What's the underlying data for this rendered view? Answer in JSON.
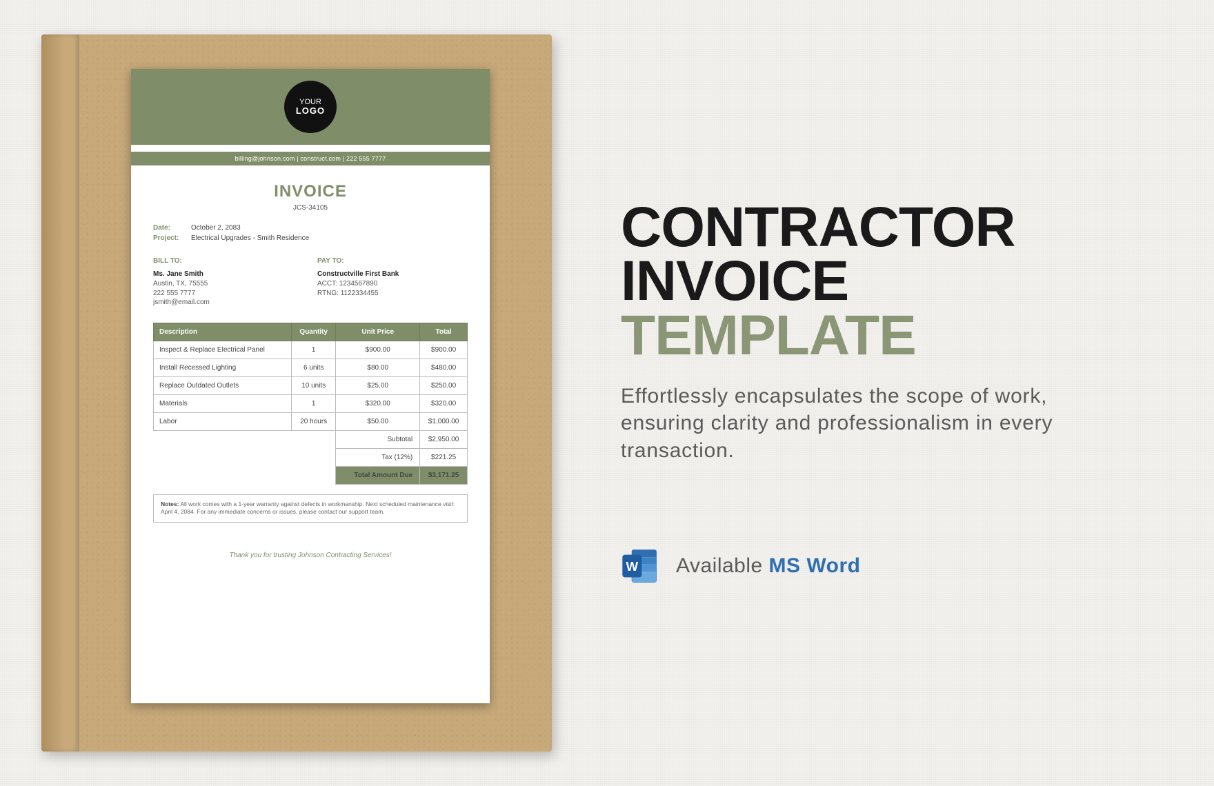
{
  "logo": {
    "line1": "YOUR",
    "line2": "LOGO"
  },
  "contact_bar": "billing@johnson.com  |  construct.com  |  222 555 7777",
  "title": "INVOICE",
  "invoice_number": "JCS-34105",
  "meta": {
    "date_label": "Date:",
    "date": "October 2, 2083",
    "project_label": "Project:",
    "project": "Electrical Upgrades - Smith Residence"
  },
  "bill_to": {
    "title": "BILL TO:",
    "name": "Ms. Jane Smith",
    "addr": "Austin, TX, 75555",
    "phone": "222 555 7777",
    "email": "jsmith@email.com"
  },
  "pay_to": {
    "title": "PAY TO:",
    "name": "Constructville First Bank",
    "acct": "ACCT: 1234567890",
    "rtng": "RTNG: 1122334455"
  },
  "columns": {
    "desc": "Description",
    "qty": "Quantity",
    "price": "Unit Price",
    "total": "Total"
  },
  "rows": [
    {
      "desc": "Inspect & Replace Electrical Panel",
      "qty": "1",
      "price": "$900.00",
      "total": "$900.00"
    },
    {
      "desc": "Install Recessed Lighting",
      "qty": "6 units",
      "price": "$80.00",
      "total": "$480.00"
    },
    {
      "desc": "Replace Outdated Outlets",
      "qty": "10 units",
      "price": "$25.00",
      "total": "$250.00"
    },
    {
      "desc": "Materials",
      "qty": "1",
      "price": "$320.00",
      "total": "$320.00"
    },
    {
      "desc": "Labor",
      "qty": "20 hours",
      "price": "$50.00",
      "total": "$1,000.00"
    }
  ],
  "summary": {
    "subtotal_label": "Subtotal",
    "subtotal": "$2,950.00",
    "tax_label": "Tax (12%)",
    "tax": "$221.25",
    "total_label": "Total Amount Due",
    "total": "$3,171.25"
  },
  "notes": {
    "label": "Notes:",
    "text": "All work comes with a 1-year warranty against defects in workmanship. Next scheduled maintenance visit: April 4, 2084. For any immediate concerns or issues, please contact our support team."
  },
  "thanks": "Thank you for trusting Johnson Contracting Services!",
  "promo": {
    "line1": "CONTRACTOR",
    "line2": "INVOICE",
    "line3": "TEMPLATE",
    "sub": "Effortlessly encapsulates the scope of work, ensuring clarity and professionalism in every transaction.",
    "avail_prefix": "Available ",
    "avail_product": "MS Word"
  }
}
